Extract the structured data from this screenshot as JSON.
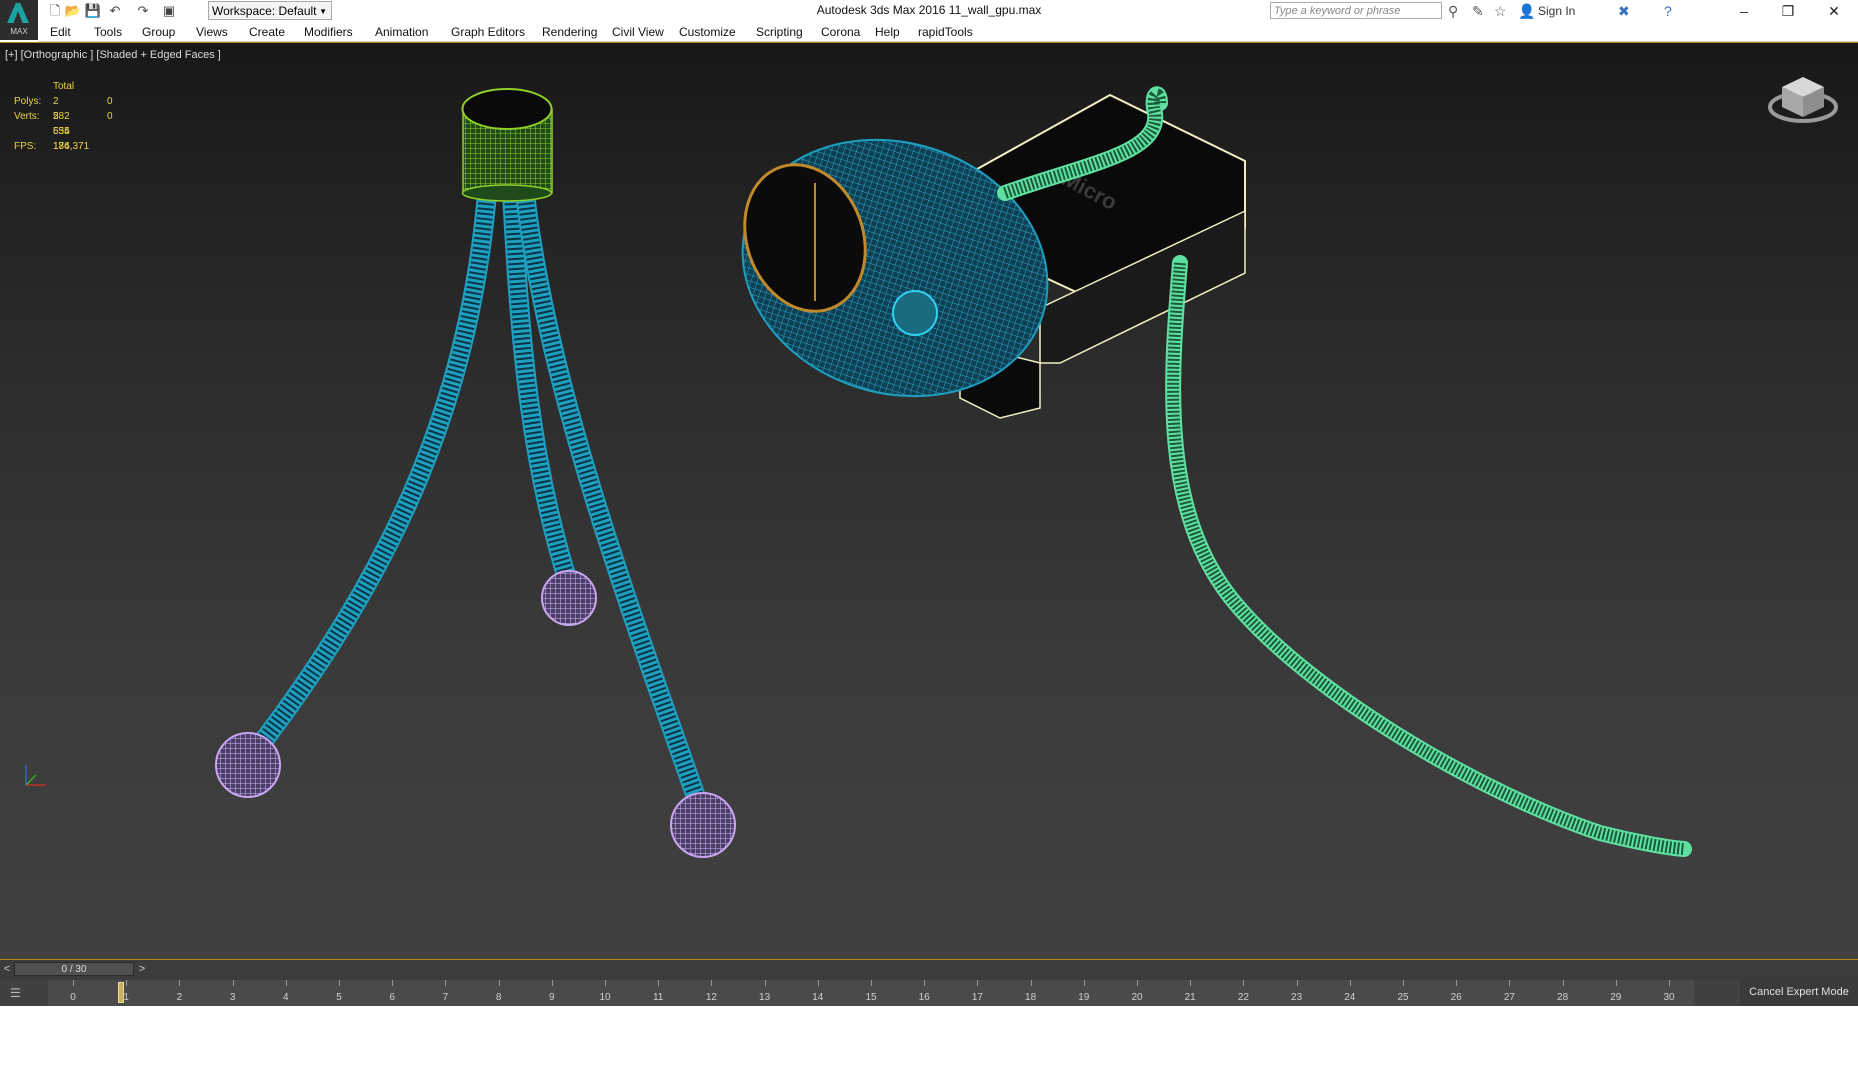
{
  "app": {
    "title": "Autodesk 3ds Max 2016     11_wall_gpu.max",
    "logo_text": "MAX",
    "workspace_label": "Workspace: Default",
    "search_placeholder": "Type a keyword or phrase",
    "sign_in": "Sign In"
  },
  "menu": [
    "Edit",
    "Tools",
    "Group",
    "Views",
    "Create",
    "Modifiers",
    "Animation",
    "Graph Editors",
    "Rendering",
    "Civil View",
    "Customize",
    "Scripting",
    "Corona",
    "Help",
    "rapidTools"
  ],
  "viewport": {
    "label": "[+] [Orthographic ] [Shaded + Edged Faces ]",
    "stats": {
      "header": "Total",
      "polys_label": "Polys:",
      "polys_total": "2 582 654",
      "polys_sel": "0",
      "verts_label": "Verts:",
      "verts_total": "2 535 186",
      "verts_sel": "0",
      "fps_label": "FPS:",
      "fps_value": "174,371"
    },
    "colors": {
      "tripod_legs": "#1e9fbf",
      "tripod_cap": "#7fbf2a",
      "feet": "#c9a6f0",
      "camera_body": "#1e9fbf",
      "cable": "#5fe0a0",
      "clip_outline": "#f3f0c0"
    }
  },
  "timeline": {
    "slider_value": "0 / 30",
    "left_arrow": "<",
    "right_arrow": ">",
    "frames": [
      "0",
      "1",
      "2",
      "3",
      "4",
      "5",
      "6",
      "7",
      "8",
      "9",
      "10",
      "11",
      "12",
      "13",
      "14",
      "15",
      "16",
      "17",
      "18",
      "19",
      "20",
      "21",
      "22",
      "23",
      "24",
      "25",
      "26",
      "27",
      "28",
      "29",
      "30"
    ]
  },
  "expert_mode": "Cancel Expert Mode",
  "icons": [
    "new-icon",
    "open-icon",
    "save-icon",
    "undo-icon",
    "redo-icon",
    "project-icon",
    "binoculars-icon",
    "star-icon",
    "user-icon",
    "close-x-icon",
    "help-icon",
    "minimize-icon",
    "restore-icon",
    "close-icon",
    "viewcube-icon",
    "axis-tripod-icon",
    "mini-listener-icon"
  ]
}
